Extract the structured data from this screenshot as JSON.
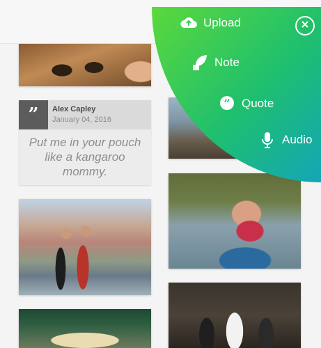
{
  "quote_card": {
    "author": "Alex Capley",
    "date": "January 04, 2016",
    "text": "Put me in your pouch like a kangaroo mommy.",
    "icon": "quote-bubble-icon"
  },
  "photos": [
    {
      "name": "photo-beach-sandals"
    },
    {
      "name": "photo-coastal-couple"
    },
    {
      "name": "photo-vintage-car"
    },
    {
      "name": "photo-lake-shore"
    },
    {
      "name": "photo-father-son"
    },
    {
      "name": "photo-wedding"
    }
  ],
  "menu": {
    "items": [
      {
        "label": "Upload",
        "icon": "cloud-upload-icon"
      },
      {
        "label": "Note",
        "icon": "leaf-note-icon"
      },
      {
        "label": "Quote",
        "icon": "quote-bubble-icon"
      },
      {
        "label": "Audio",
        "icon": "microphone-icon"
      }
    ],
    "close_icon": "close-icon",
    "colors": {
      "start": "#5bd93c",
      "mid": "#1fbf6e",
      "end": "#14a5b8"
    }
  }
}
